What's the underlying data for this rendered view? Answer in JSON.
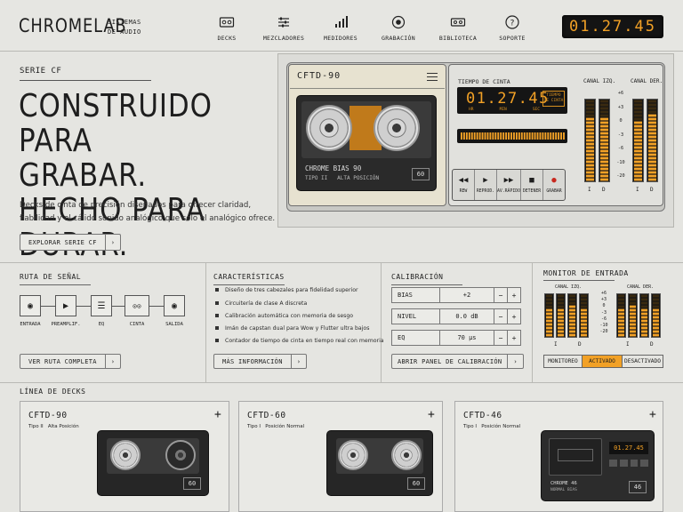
{
  "brand": {
    "name": "CHROMELAB",
    "sub1": "SISTEMAS",
    "sub2": "DE AUDIO"
  },
  "nav": [
    {
      "label": "DECKS",
      "icon": "cassette-icon"
    },
    {
      "label": "MEZCLADORES",
      "icon": "sliders-icon"
    },
    {
      "label": "MEDIDORES",
      "icon": "bar-chart-icon"
    },
    {
      "label": "GRABACIÓN",
      "icon": "record-icon"
    },
    {
      "label": "BIBLIOTECA",
      "icon": "library-cassette-icon"
    },
    {
      "label": "SOPORTE",
      "icon": "help-icon"
    }
  ],
  "clock": "01.27.45",
  "hero": {
    "eyebrow": "SERIE CF",
    "title_lines": [
      "CONSTRUIDO PARA",
      "GRABAR. HECHO PARA",
      "DURAR."
    ],
    "desc_lines": [
      "Decks de cinta de precisión diseñados para ofrecer claridad,",
      "fiabilidad y el cálido sonido analógico que solo el analógico ofrece."
    ],
    "cta": "EXPLORAR SERIE CF",
    "cta_arrow": "›"
  },
  "deck": {
    "model": "CFTD-90",
    "cassette_label": "CHROME BIAS 90",
    "cassette_type": "TIPO II",
    "cassette_position": "ALTA POSICIÓN",
    "cassette_number": "60",
    "tape_time_label": "TIEMPO DE CINTA",
    "tape_time": "01.27.45",
    "units": [
      "HR",
      "MIN",
      "SEC"
    ],
    "badge": "TIEMPO DE CINTA",
    "transport": [
      {
        "glyph": "◀◀",
        "label": "REW"
      },
      {
        "glyph": "▶",
        "label": "REPROD."
      },
      {
        "glyph": "▶▶",
        "label": "AV.RÁPIDO"
      },
      {
        "glyph": "■",
        "label": "DETENER"
      },
      {
        "glyph": "●",
        "label": "GRABAR"
      }
    ],
    "vu_left_label": "CANAL IZQ.",
    "vu_right_label": "CANAL DER.",
    "vu_scale": [
      "+6",
      "+3",
      "0",
      "-3",
      "-6",
      "-10",
      "-20"
    ],
    "vu_ch": [
      "I",
      "D"
    ],
    "vu_levels": [
      0.82,
      0.8,
      0.78,
      0.84
    ]
  },
  "signal": {
    "title": "RUTA DE SEÑAL",
    "nodes": [
      {
        "label": "ENTRADA",
        "glyph": "◉",
        "icon": "input-icon"
      },
      {
        "label": "PREAMPLIF.",
        "glyph": "▶",
        "icon": "preamp-icon"
      },
      {
        "label": "EQ",
        "glyph": "☰",
        "icon": "eq-icon"
      },
      {
        "label": "CINTA",
        "glyph": "⊙⊙",
        "icon": "tape-icon"
      },
      {
        "label": "SALIDA",
        "glyph": "◉",
        "icon": "output-icon"
      }
    ],
    "button": "VER RUTA COMPLETA",
    "arrow": "›"
  },
  "features": {
    "title": "CARACTERÍSTICAS",
    "items": [
      "Diseño de tres cabezales para fidelidad superior",
      "Circuitería de clase A discreta",
      "Calibración automática con memoria de sesgo",
      "Imán de capstan dual para Wow y Flutter ultra bajos",
      "Contador de tiempo de cinta en tiempo real con memoria"
    ],
    "button": "MÁS INFORMACIÓN",
    "arrow": "›"
  },
  "calibration": {
    "title": "CALIBRACIÓN",
    "rows": [
      {
        "name": "BIAS",
        "value": "+2"
      },
      {
        "name": "NIVEL",
        "value": "0.0 dB"
      },
      {
        "name": "EQ",
        "value": "70 µs"
      }
    ],
    "minus": "−",
    "plus": "+",
    "button": "ABRIR PANEL DE CALIBRACIÓN",
    "arrow": "›"
  },
  "monitor": {
    "title": "MONITOR DE ENTRADA",
    "left_label": "CANAL IZQ.",
    "right_label": "CANAL DER.",
    "scale": [
      "+6",
      "+3",
      "0",
      "-3",
      "-6",
      "-10",
      "-20"
    ],
    "ch": [
      "I",
      "D"
    ],
    "levels": [
      0.7,
      0.72,
      0.75,
      0.7,
      0.74,
      0.78,
      0.72,
      0.68
    ],
    "toggle": [
      "MONITOREO",
      "ACTIVADO",
      "DESACTIVADO"
    ],
    "active": "ACTIVADO"
  },
  "lineup": {
    "title": "LÍNEA DE DECKS",
    "cards": [
      {
        "model": "CFTD-90",
        "type": "Tipo II",
        "position": "Alta Posición",
        "number": "60"
      },
      {
        "model": "CFTD-60",
        "type": "Tipo I",
        "position": "Posición Normal",
        "number": "60"
      },
      {
        "model": "CFTD-46",
        "type": "Tipo I",
        "position": "Posición Normal",
        "number": "46",
        "mini_time": "01.27.45",
        "label": "CHROME 46",
        "sublabel": "NORMAL BIAS"
      }
    ],
    "plus": "+"
  },
  "colors": {
    "accent": "#f2a126",
    "lcd_bg": "#151515",
    "panel": "#e5e5e1"
  }
}
